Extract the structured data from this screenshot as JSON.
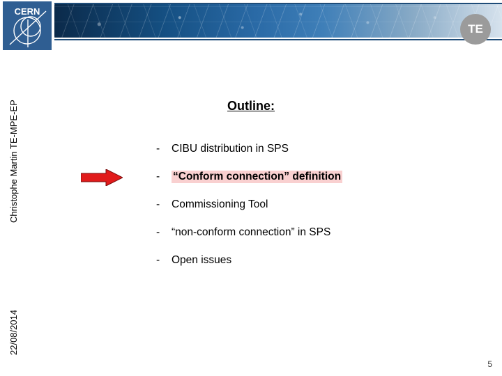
{
  "header": {
    "org_logo_label": "CERN",
    "dept_badge": "TE"
  },
  "sidebar": {
    "author": "Christophe Martin TE-MPE-EP",
    "date": "22/08/2014"
  },
  "body": {
    "title": "Outline:",
    "items": [
      {
        "dash": "-",
        "text": "CIBU distribution in SPS",
        "highlight": false
      },
      {
        "dash": "-",
        "text": "“Conform connection” definition",
        "highlight": true
      },
      {
        "dash": "-",
        "text": "Commissioning Tool",
        "highlight": false
      },
      {
        "dash": "-",
        "text": "“non-conform connection” in SPS",
        "highlight": false
      },
      {
        "dash": "-",
        "text": "Open issues",
        "highlight": false
      }
    ],
    "current_index": 1
  },
  "footer": {
    "page_number": "5"
  },
  "colors": {
    "highlight_bg": "#f9d0d0",
    "arrow_fill": "#e11b1b",
    "banner_blue": "#1e4c78",
    "badge_gray": "#9b9b9b",
    "logo_blue": "#2f5e92"
  }
}
